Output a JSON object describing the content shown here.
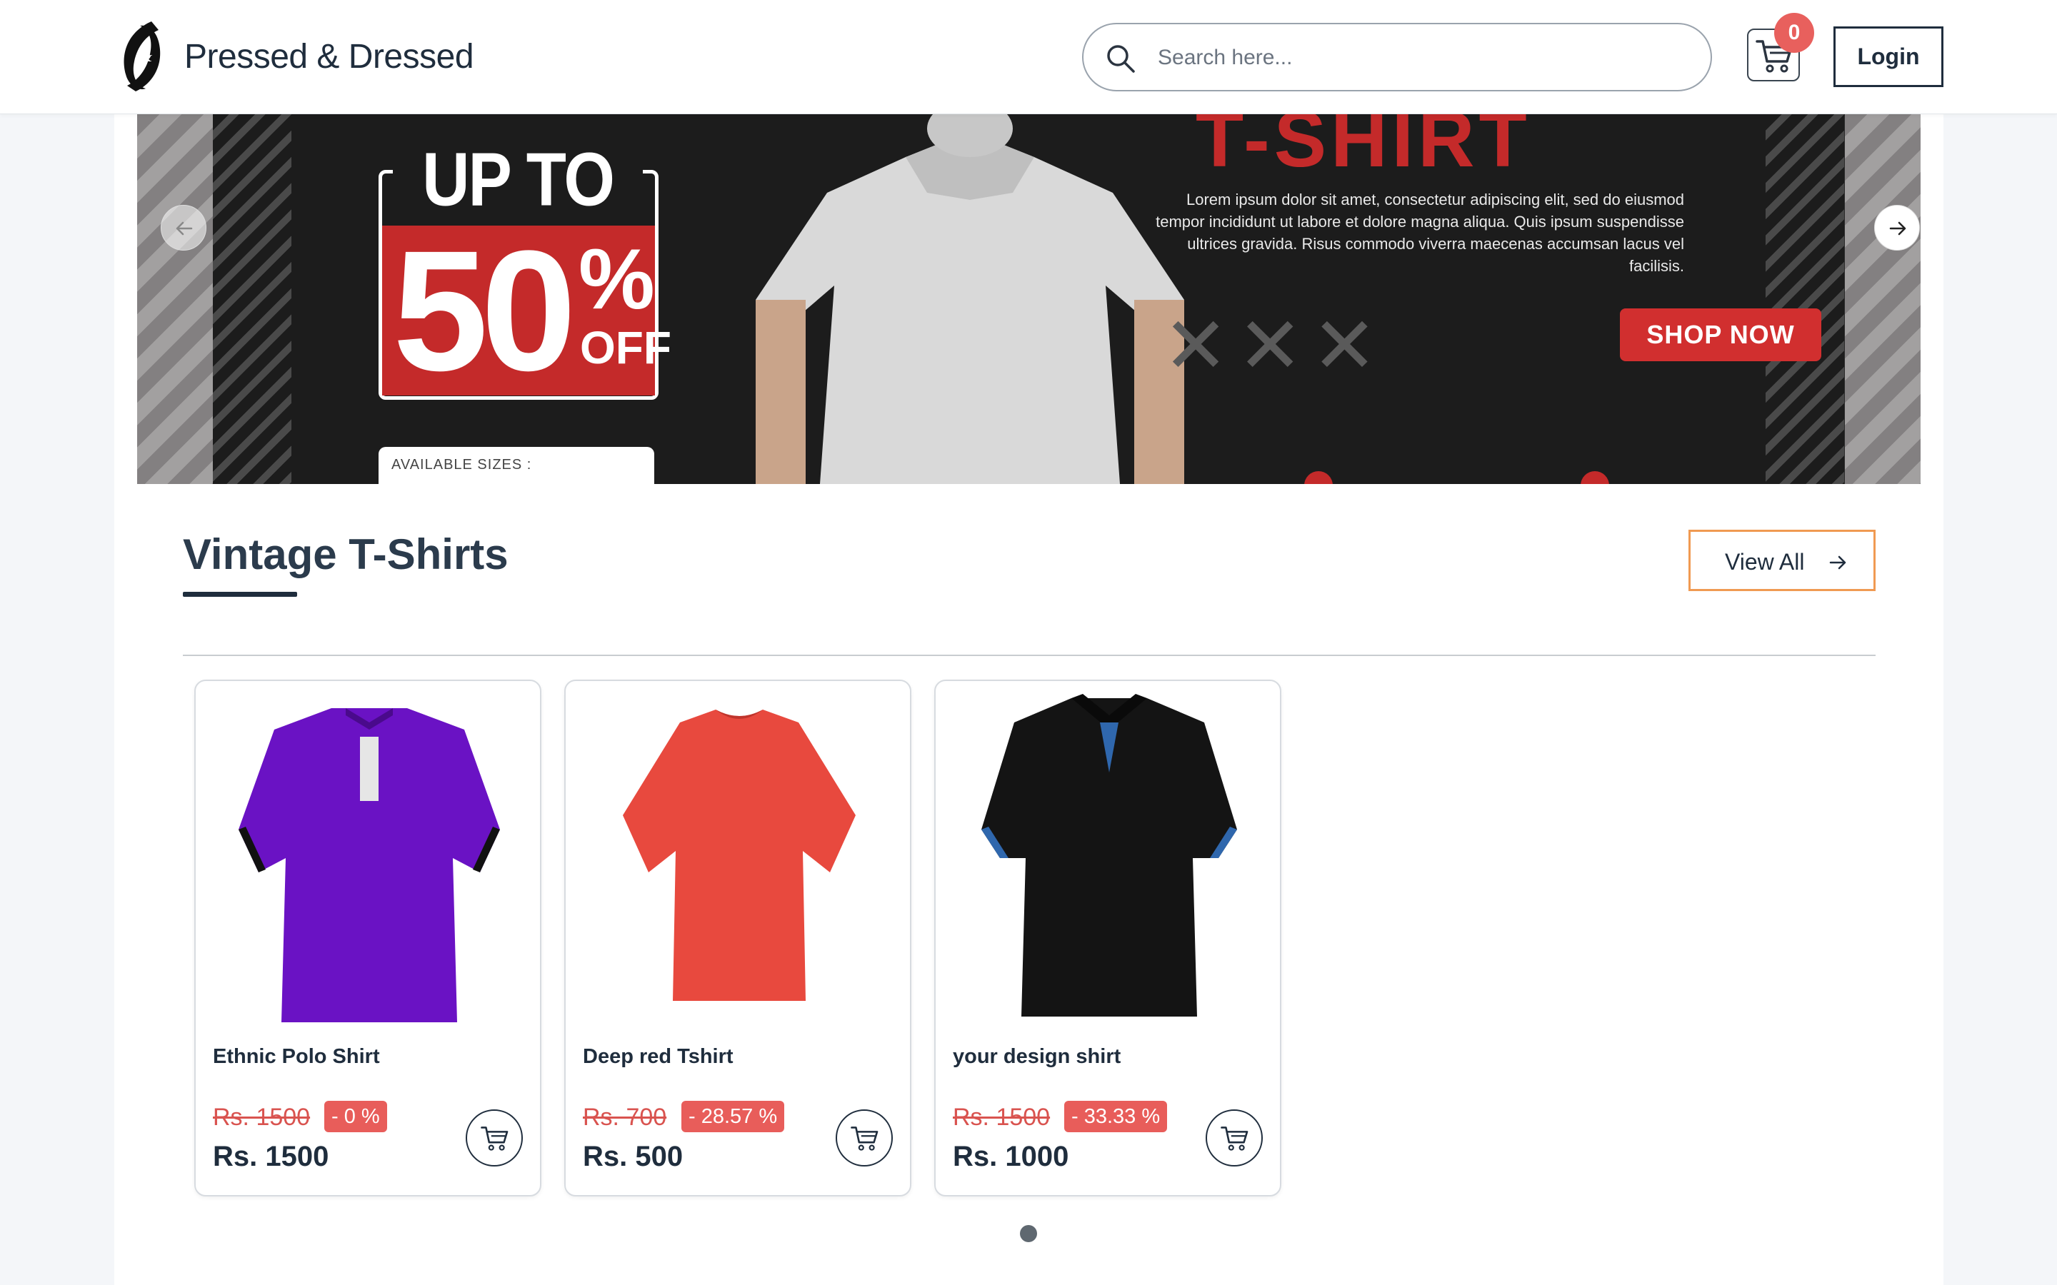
{
  "header": {
    "brand": "Pressed & Dressed",
    "logo_text": "PRESSED DRESSED",
    "search_placeholder": "Search here...",
    "cart_count": "0",
    "login_label": "Login"
  },
  "banner": {
    "promo_upto": "UP TO",
    "promo_value": "50",
    "promo_pct": "%",
    "promo_off": "OFF",
    "headline": "T-SHIRT",
    "lorem": "Lorem ipsum dolor sit amet, consectetur adipiscing elit, sed do eiusmod tempor incididunt ut labore et dolore magna aliqua. Quis ipsum suspendisse ultrices gravida. Risus commodo viverra maecenas accumsan lacus vel facilisis.",
    "cta": "SHOP NOW",
    "sizes_label": "AVAILABLE SIZES :"
  },
  "section": {
    "title": "Vintage T-Shirts",
    "view_all": "View All"
  },
  "products": [
    {
      "name": "Ethnic Polo Shirt",
      "old_price": "Rs. 1500",
      "discount": "- 0 %",
      "price": "Rs. 1500",
      "color": "#6a12c4"
    },
    {
      "name": "Deep red Tshirt",
      "old_price": "Rs. 700",
      "discount": "- 28.57 %",
      "price": "Rs. 500",
      "color": "#e8493e"
    },
    {
      "name": "your design shirt",
      "old_price": "Rs. 1500",
      "discount": "- 33.33 %",
      "price": "Rs. 1000",
      "color": "#141414"
    }
  ],
  "colors": {
    "accent_orange": "#f09a52",
    "badge_red": "#e85d5a",
    "text_dark": "#1f2d3d"
  },
  "icons": {
    "search": "search-icon",
    "cart": "cart-icon",
    "prev": "arrow-left-icon",
    "next": "arrow-right-icon",
    "view_all_arrow": "arrow-right-icon",
    "add_to_cart": "cart-icon"
  }
}
